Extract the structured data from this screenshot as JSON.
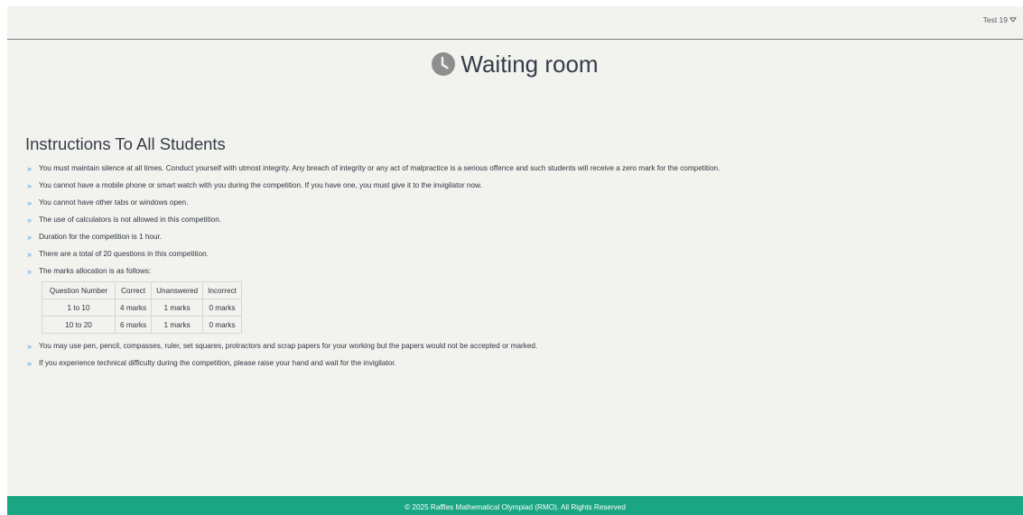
{
  "header": {
    "user_label": "Test 19",
    "user_menu_icon": "chevron-down-icon"
  },
  "page": {
    "title": "Waiting room",
    "title_icon": "clock-icon"
  },
  "instructions": {
    "heading": "Instructions To All Students",
    "items_before_table": [
      "You must maintain silence at all times. Conduct yourself with utmost integrity. Any breach of integrity or any act of malpractice is a serious offence and such students will receive a zero mark for the competition.",
      "You cannot have a mobile phone or smart watch with you during the competition. If you have one, you must give it to the invigilator now.",
      "You cannot have other tabs or windows open.",
      "The use of calculators is not allowed in this competition.",
      "Duration for the competition is 1 hour.",
      "There are a total of 20 questions in this competition.",
      "The marks allocation is as follows:"
    ],
    "items_after_table": [
      "You may use pen, pencil, compasses, ruler, set squares, protractors and scrap papers for your working but the papers would not be accepted or marked.",
      "If you experience technical difficulty during the competition, please raise your hand and wait for the invigilator."
    ]
  },
  "marks_table": {
    "headers": [
      "Question Number",
      "Correct",
      "Unanswered",
      "Incorrect"
    ],
    "rows": [
      [
        "1 to 10",
        "4 marks",
        "1 marks",
        "0 marks"
      ],
      [
        "10 to 20",
        "6 marks",
        "1 marks",
        "0 marks"
      ]
    ]
  },
  "footer": {
    "text": "© 2025 Raffles Mathematical Olympiad (RMO). All Rights Reserved"
  },
  "colors": {
    "background": "#f2f2ee",
    "footer": "#1aa683",
    "bullet": "#5fa0d4",
    "title_text": "#353d49",
    "clock_icon": "#8e8e8e"
  }
}
